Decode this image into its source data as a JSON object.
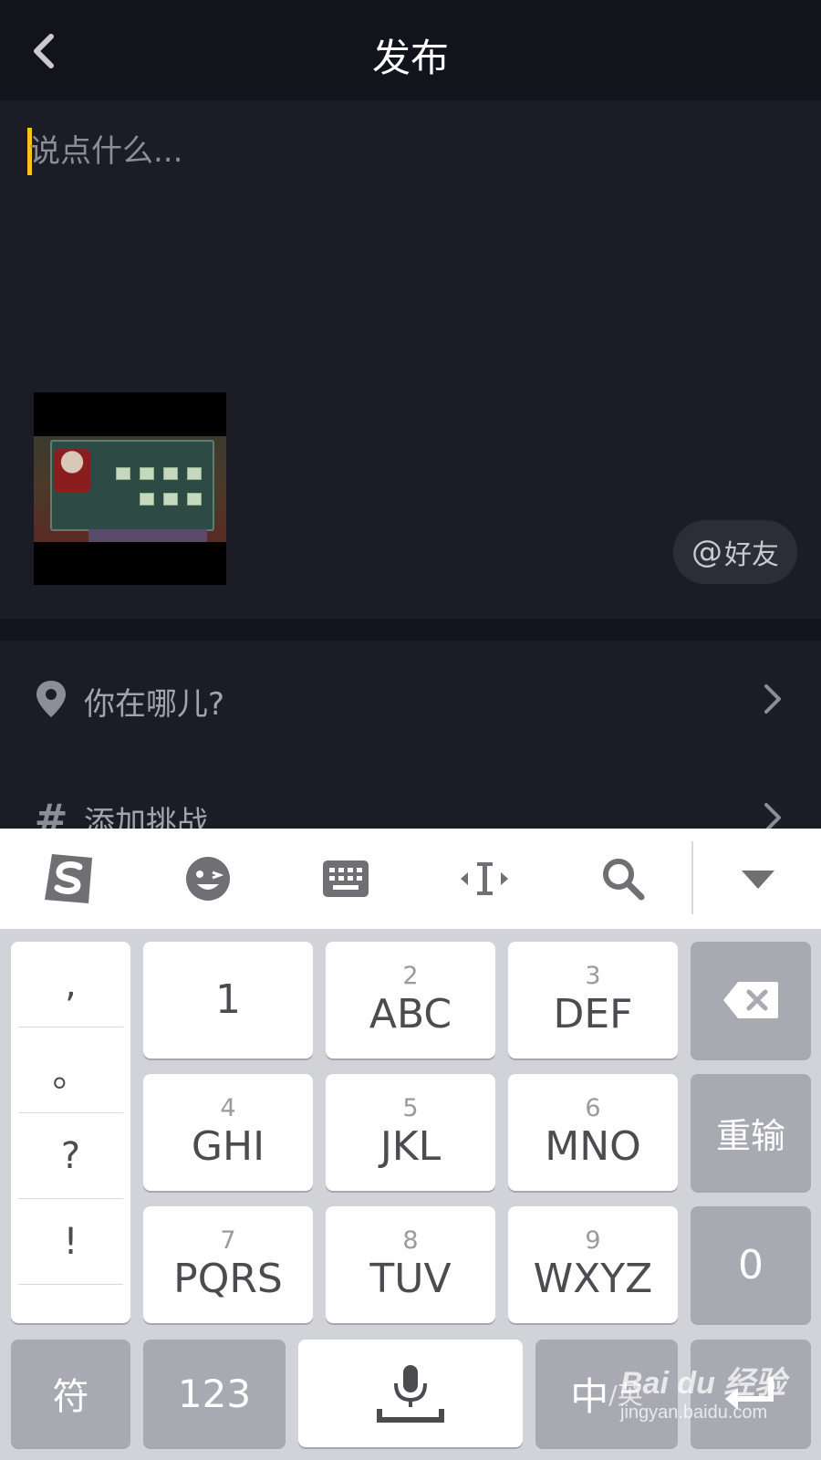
{
  "header": {
    "title": "发布",
    "back_icon": "chevron-left-icon"
  },
  "compose": {
    "placeholder": "说点什么...",
    "value": "",
    "caret_color": "#f5c518",
    "mention_symbol": "@",
    "mention_label": "好友"
  },
  "options": [
    {
      "icon": "location-pin-icon",
      "label": "你在哪儿?"
    },
    {
      "icon": "hashtag-icon",
      "glyph": "#",
      "label": "添加挑战"
    }
  ],
  "keyboard": {
    "toolbar": [
      "sogou-logo-icon",
      "emoji-icon",
      "keyboard-icon",
      "cursor-move-icon",
      "search-icon",
      "collapse-keyboard-icon"
    ],
    "punctuation": [
      ",",
      "。",
      "?",
      "!"
    ],
    "keys": [
      {
        "num": "",
        "letters": "1"
      },
      {
        "num": "2",
        "letters": "ABC"
      },
      {
        "num": "3",
        "letters": "DEF"
      },
      {
        "num": "4",
        "letters": "GHI"
      },
      {
        "num": "5",
        "letters": "JKL"
      },
      {
        "num": "6",
        "letters": "MNO"
      },
      {
        "num": "7",
        "letters": "PQRS"
      },
      {
        "num": "8",
        "letters": "TUV"
      },
      {
        "num": "9",
        "letters": "WXYZ"
      }
    ],
    "side": {
      "backspace_icon": "backspace-icon",
      "retype": "重输",
      "zero": "0"
    },
    "bottom": {
      "symbols": "符",
      "numbers": "123",
      "space_icon": "microphone-space-icon",
      "lang_main": "中",
      "lang_alt": "/英",
      "enter_icon": "enter-icon"
    }
  },
  "watermark": {
    "main": "Bai du 经验",
    "sub": "jingyan.baidu.com"
  }
}
